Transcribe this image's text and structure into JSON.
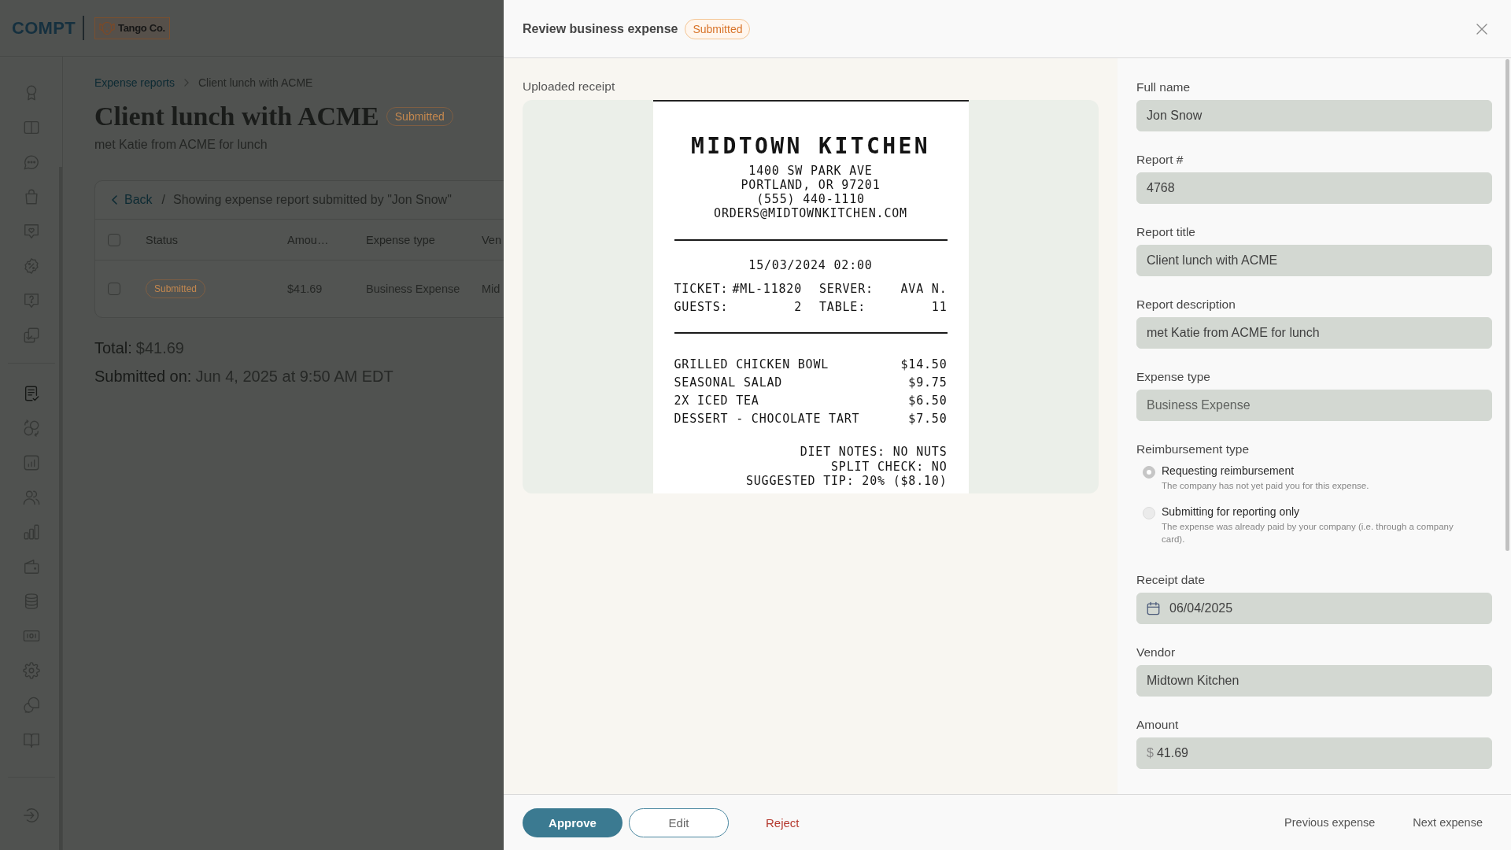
{
  "app_header": {
    "logo": "COMPT",
    "company_logo": "Tango Co."
  },
  "sidebar": {
    "items": [
      {
        "kind": "award",
        "selected": false
      },
      {
        "kind": "book",
        "selected": false
      },
      {
        "kind": "chat",
        "selected": false
      },
      {
        "kind": "bag",
        "selected": false
      },
      {
        "kind": "heart-message",
        "selected": false
      },
      {
        "kind": "percent",
        "selected": false
      },
      {
        "kind": "help-message",
        "selected": false
      },
      {
        "kind": "copy-check",
        "selected": false
      }
    ],
    "admin_items": [
      {
        "kind": "document-check",
        "selected": true
      },
      {
        "kind": "exchange",
        "selected": false
      },
      {
        "kind": "chart",
        "selected": false
      },
      {
        "kind": "users",
        "selected": false
      },
      {
        "kind": "bar-chart",
        "selected": false
      },
      {
        "kind": "wallet",
        "selected": false
      },
      {
        "kind": "database",
        "selected": false
      },
      {
        "kind": "money",
        "selected": false
      },
      {
        "kind": "settings",
        "selected": false
      },
      {
        "kind": "chat-bubbles",
        "selected": false
      },
      {
        "kind": "open-book",
        "selected": false
      }
    ],
    "bottom_items": [
      {
        "kind": "sign-in",
        "selected": false
      }
    ]
  },
  "breadcrumb": [
    {
      "label": "Expense reports",
      "current": false
    },
    {
      "label": "Client lunch with ACME",
      "current": true
    }
  ],
  "report": {
    "title": "Client lunch with ACME",
    "status": "Submitted",
    "description": "met Katie from ACME for lunch"
  },
  "expense_table": {
    "back": "Back",
    "separator": "/",
    "caption": "Showing expense report submitted by \"Jon Snow\"",
    "select_all_checked": false,
    "columns": [
      "Status",
      "Amou…",
      "Expense type",
      "Ven"
    ],
    "rows": [
      {
        "checked": false,
        "cells": [
          "Submitted",
          "$41.69",
          "Business Expense",
          "Mid"
        ]
      }
    ]
  },
  "summary": [
    {
      "label": "Total:",
      "value": "$41.69"
    },
    {
      "label": "Submitted on:",
      "value": "Jun 4, 2025 at 9:50 AM EDT"
    }
  ],
  "drawer": {
    "title": "Review business expense",
    "status": "Submitted"
  },
  "receipt_panel": {
    "label": "Uploaded receipt",
    "receipt": {
      "name": "MIDTOWN KITCHEN",
      "address_lines": [
        "1400 SW PARK AVE",
        "PORTLAND, OR 97201",
        "(555) 440-1110",
        "ORDERS@MIDTOWNKITCHEN.COM"
      ],
      "datetime": "15/03/2024 02:00",
      "details": [
        {
          "label": "TICKET:",
          "value": "#ML-11820"
        },
        {
          "label": "SERVER:",
          "value": "AVA N."
        },
        {
          "label": "GUESTS:",
          "value": "2"
        },
        {
          "label": "TABLE:",
          "value": "11"
        }
      ],
      "items": [
        {
          "name": "GRILLED CHICKEN BOWL",
          "price": "$14.50"
        },
        {
          "name": "SEASONAL SALAD",
          "price": "$9.75"
        },
        {
          "name": "2X ICED TEA",
          "price": "$6.50"
        },
        {
          "name": "DESSERT - CHOCOLATE TART",
          "price": "$7.50"
        }
      ],
      "notes": [
        "DIET NOTES: NO NUTS",
        "SPLIT CHECK: NO",
        "SUGGESTED TIP: 20% ($8.10)"
      ]
    }
  },
  "form": {
    "disabled": true,
    "fields": [
      {
        "kind": "text",
        "label": "Full name",
        "value": "Jon Snow"
      },
      {
        "kind": "text",
        "label": "Report #",
        "value": "4768"
      },
      {
        "kind": "text",
        "label": "Report title",
        "value": "Client lunch with ACME"
      },
      {
        "kind": "text",
        "label": "Report description",
        "value": "met Katie from ACME for lunch"
      },
      {
        "kind": "select",
        "label": "Expense type",
        "value": "Business Expense"
      },
      {
        "kind": "radio",
        "label": "Reimbursement type",
        "options": [
          {
            "label": "Requesting reimbursement",
            "hint": "The company has not yet paid you for this expense.",
            "selected": true
          },
          {
            "label": "Submitting for reporting only",
            "hint": "The expense was already paid by your company (i.e. through a company card).",
            "selected": false
          }
        ]
      },
      {
        "kind": "date",
        "label": "Receipt date",
        "value": "06/04/2025"
      },
      {
        "kind": "text",
        "label": "Vendor",
        "value": "Midtown Kitchen"
      },
      {
        "kind": "currency",
        "label": "Amount",
        "prefix": "$",
        "value": "41.69"
      }
    ]
  },
  "footer": {
    "actions": [
      {
        "kind": "approve",
        "label": "Approve"
      },
      {
        "kind": "edit",
        "label": "Edit"
      },
      {
        "kind": "reject",
        "label": "Reject"
      }
    ],
    "navigation": [
      {
        "label": "Previous expense"
      },
      {
        "label": "Next expense"
      }
    ]
  }
}
